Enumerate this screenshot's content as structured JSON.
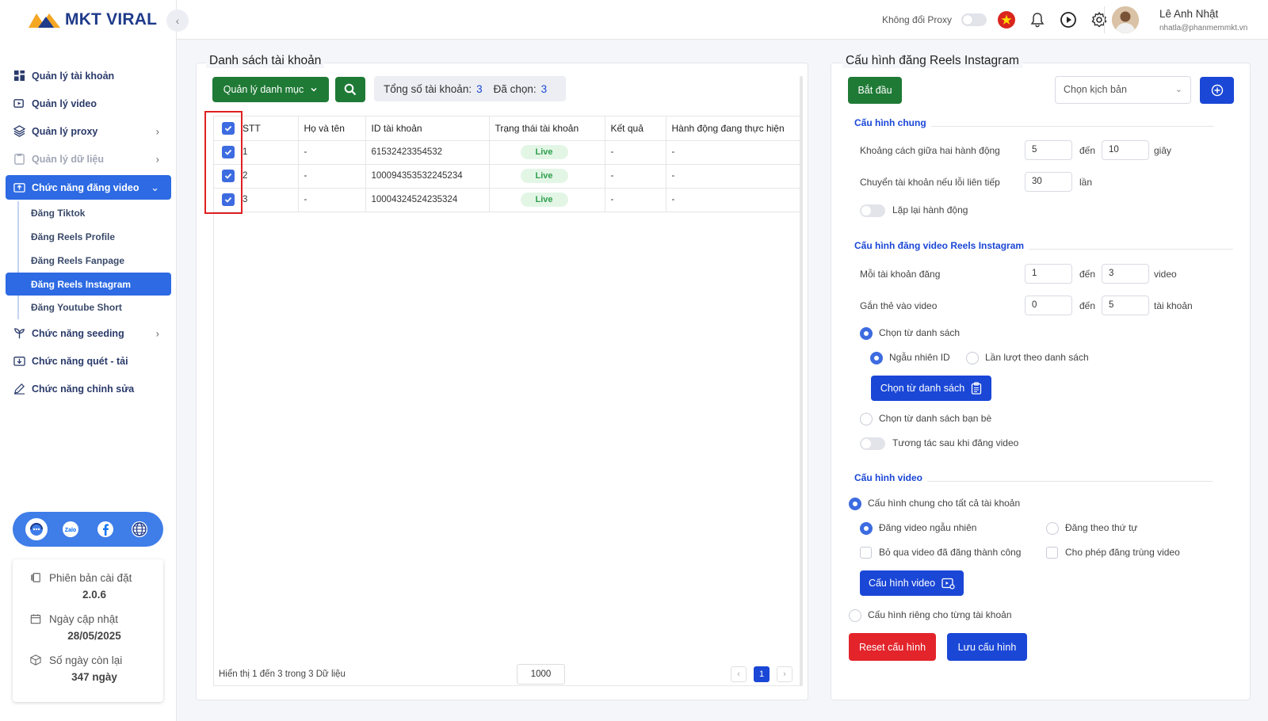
{
  "app": {
    "logo_text": "MKT VIRAL"
  },
  "sidebar": {
    "items": [
      {
        "label": "Quản lý tài khoản"
      },
      {
        "label": "Quản lý video"
      },
      {
        "label": "Quản lý proxy"
      },
      {
        "label": "Quản lý dữ liệu"
      },
      {
        "label": "Chức năng đăng video"
      },
      {
        "label": "Chức năng seeding"
      },
      {
        "label": "Chức năng quét - tải"
      },
      {
        "label": "Chức năng chỉnh sửa"
      }
    ],
    "sub_items": [
      {
        "label": "Đăng Tiktok"
      },
      {
        "label": "Đăng Reels Profile"
      },
      {
        "label": "Đăng Reels Fanpage"
      },
      {
        "label": "Đăng Reels Instagram"
      },
      {
        "label": "Đăng Youtube Short"
      }
    ],
    "info": {
      "version_label": "Phiên bản cài đặt",
      "version": "2.0.6",
      "update_label": "Ngày cập nhật",
      "update_date": "28/05/2025",
      "remaining_label": "Số ngày còn lại",
      "remaining": "347 ngày"
    }
  },
  "topbar": {
    "proxy_label": "Không đổi Proxy",
    "user_name": "Lê Anh Nhật",
    "user_email": "nhatla@phanmemmkt.vn"
  },
  "left_panel": {
    "title": "Danh sách tài khoản",
    "category_button": "Quản lý danh mục",
    "total_label": "Tổng số tài khoản:",
    "total": "3",
    "selected_label": "Đã chọn:",
    "selected": "3",
    "columns": [
      "STT",
      "Họ và tên",
      "ID tài khoản",
      "Trạng thái tài khoản",
      "Kết quả",
      "Hành động đang thực hiện"
    ],
    "rows": [
      {
        "stt": "1",
        "name": "-",
        "id": "61532423354532",
        "status": "Live",
        "result": "-",
        "action": "-"
      },
      {
        "stt": "2",
        "name": "-",
        "id": "100094353532245234",
        "status": "Live",
        "result": "-",
        "action": "-"
      },
      {
        "stt": "3",
        "name": "-",
        "id": "10004324524235324",
        "status": "Live",
        "result": "-",
        "action": "-"
      }
    ],
    "footer_text": "Hiển thị 1 đến 3 trong 3 Dữ liệu",
    "page_size": "1000",
    "current_page": "1"
  },
  "right_panel": {
    "title": "Cấu hình đăng Reels Instagram",
    "start_button": "Bắt đầu",
    "script_placeholder": "Chọn kịch bản",
    "general": {
      "title": "Cấu hình chung",
      "interval_label": "Khoảng cách giữa hai hành động",
      "interval_from": "5",
      "interval_to": "10",
      "to_word": "đến",
      "interval_unit": "giây",
      "switch_label": "Chuyển tài khoản nếu lỗi liên tiếp",
      "switch_value": "30",
      "switch_unit": "lần",
      "repeat_label": "Lặp lại hành động"
    },
    "reels": {
      "title": "Cấu hình đăng video Reels Instagram",
      "per_account_label": "Mỗi tài khoản đăng",
      "per_from": "1",
      "per_to": "3",
      "per_unit": "video",
      "tag_label": "Gắn thẻ vào video",
      "tag_from": "0",
      "tag_to": "5",
      "tag_unit": "tài khoản",
      "from_list_label": "Chọn từ danh sách",
      "random_id_label": "Ngẫu nhiên ID",
      "sequential_label": "Lần lượt theo danh sách",
      "from_list_button": "Chọn từ danh sách",
      "friends_label": "Chọn từ danh sách bạn bè",
      "interact_label": "Tương tác sau khi đăng video"
    },
    "video": {
      "title": "Cấu hình video",
      "common_label": "Cấu hình chung cho tất cả tài khoản",
      "random_label": "Đăng video ngẫu nhiên",
      "ordered_label": "Đăng theo thứ tự",
      "skip_label": "Bỏ qua video đã đăng thành công",
      "dup_label": "Cho phép đăng trùng video",
      "config_button": "Cấu hình video",
      "individual_label": "Cấu hình riêng cho từng tài khoản"
    },
    "reset_button": "Reset cấu hình",
    "save_button": "Lưu cấu hình"
  },
  "colors": {
    "primary": "#1a47d6",
    "green": "#1f7a36",
    "red": "#e3242b",
    "sidebar_active": "#2d6ae3"
  }
}
